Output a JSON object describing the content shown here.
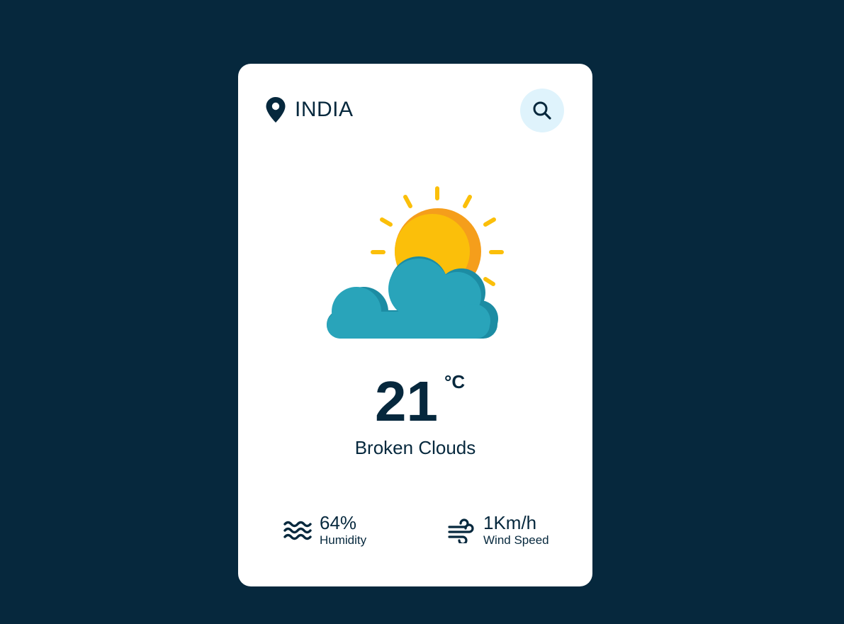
{
  "location": {
    "city": "INDIA",
    "icon": "location-pin-icon"
  },
  "search": {
    "icon": "search-icon",
    "bg_color": "#dff3fc"
  },
  "weather": {
    "icon": "sun-behind-cloud-icon",
    "temperature": "21",
    "unit": "°C",
    "description": "Broken Clouds"
  },
  "details": {
    "humidity": {
      "value": "64%",
      "label": "Humidity",
      "icon": "waves-icon"
    },
    "wind": {
      "value": "1Km/h",
      "label": "Wind Speed",
      "icon": "wind-icon"
    }
  },
  "colors": {
    "background": "#06283d",
    "card": "#ffffff",
    "text": "#06283d",
    "sun": "#fbbf0a",
    "sun_shade": "#f59e1b",
    "cloud": "#29a4ba",
    "cloud_shade": "#1c8ca3"
  }
}
